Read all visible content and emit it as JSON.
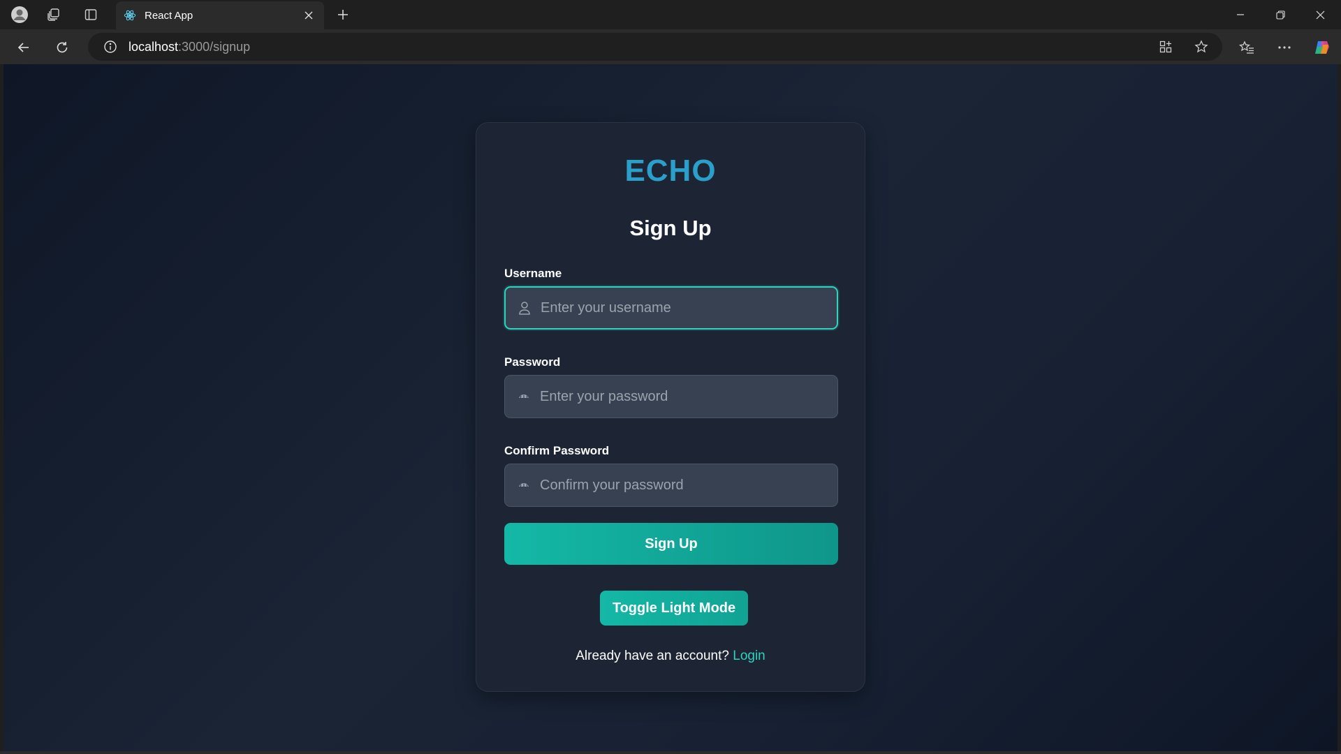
{
  "browser": {
    "tab_title": "React App",
    "address": {
      "host": "localhost",
      "path": ":3000/signup"
    }
  },
  "page": {
    "brand": "ECHO",
    "heading": "Sign Up",
    "username": {
      "label": "Username",
      "placeholder": "Enter your username",
      "icon": "user-icon"
    },
    "password": {
      "label": "Password",
      "placeholder": "Enter your password",
      "icon": "eye-closed-icon"
    },
    "confirm": {
      "label": "Confirm Password",
      "placeholder": "Confirm your password",
      "icon": "eye-closed-icon"
    },
    "submit_label": "Sign Up",
    "toggle_label": "Toggle Light Mode",
    "footer_text": "Already have an account?",
    "login_link": "Login"
  },
  "colors": {
    "accent": "#14b8a6",
    "brand": "#2a9fc9",
    "focus_border": "#2dd4bf",
    "card_bg": "#1d2535"
  }
}
